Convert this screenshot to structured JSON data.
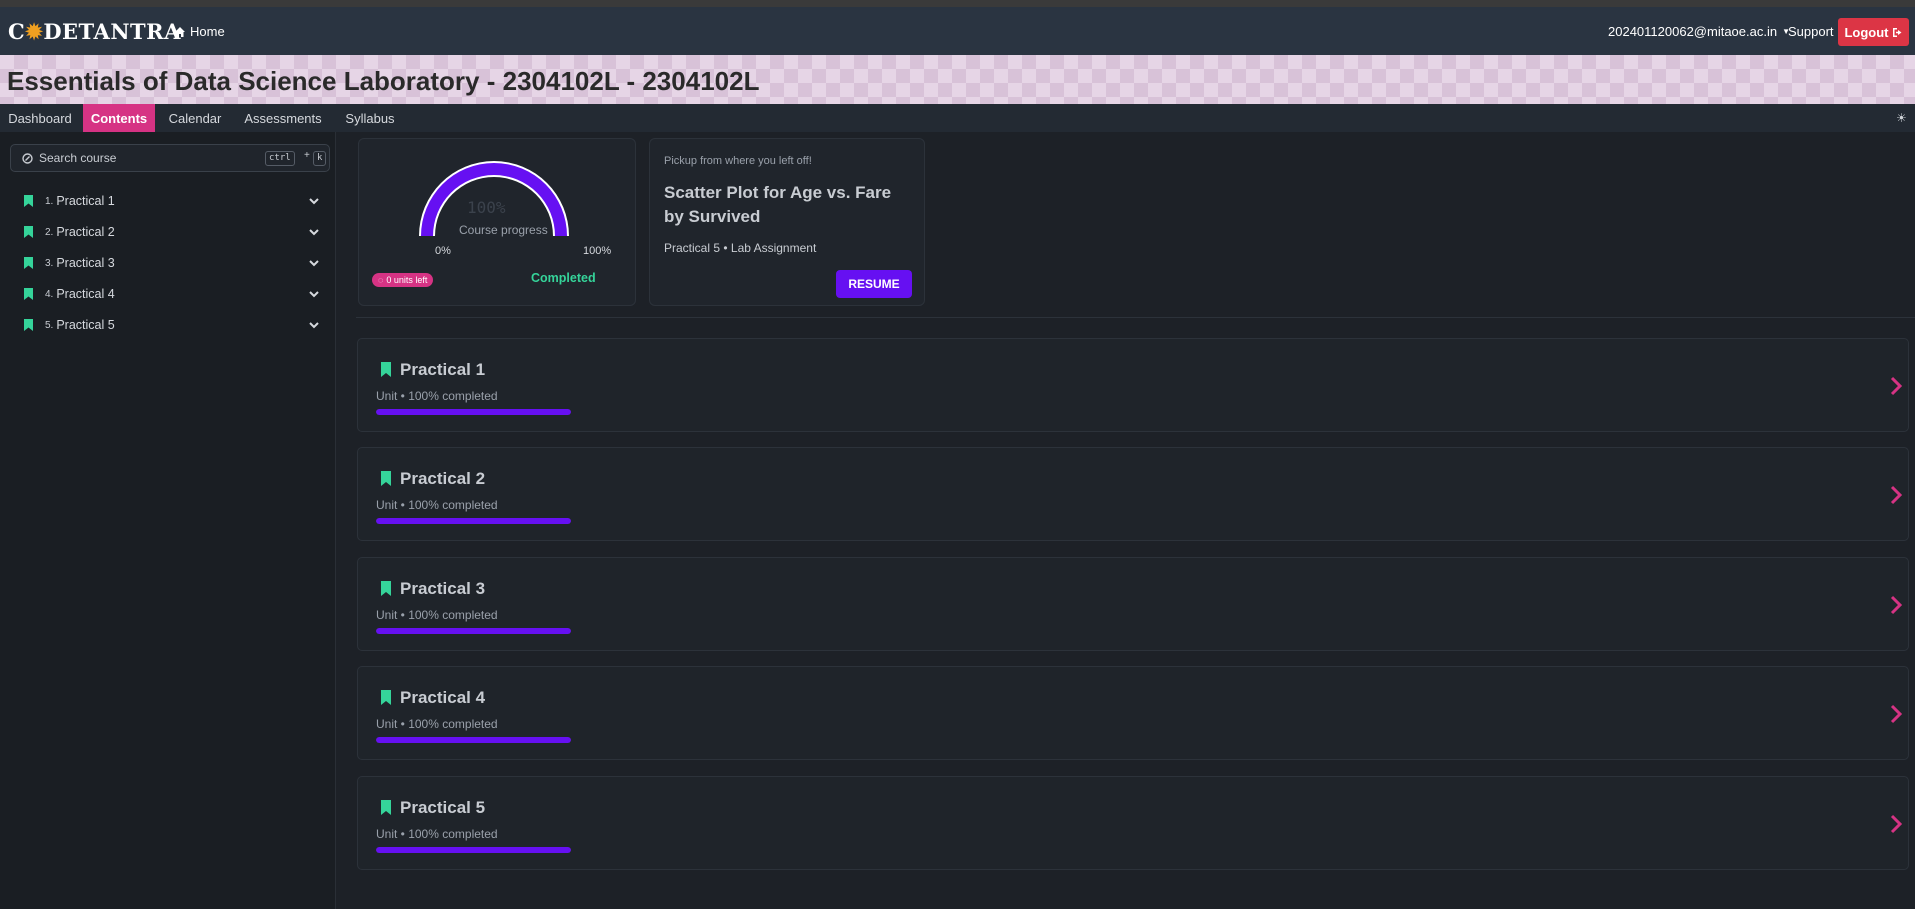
{
  "navbar": {
    "logo": "CODETANTRA",
    "home_label": "Home",
    "user_email": "202401120062@mitaoe.ac.in",
    "support_label": "Support",
    "logout_label": "Logout"
  },
  "banner": {
    "course_title": "Essentials of Data Science Laboratory - 2304102L - 2304102L"
  },
  "tabs": [
    {
      "label": "Dashboard"
    },
    {
      "label": "Contents",
      "active": true
    },
    {
      "label": "Calendar"
    },
    {
      "label": "Assessments"
    },
    {
      "label": "Syllabus"
    }
  ],
  "sidebar": {
    "search_placeholder": "Search course",
    "shortcut_key1": "ctrl",
    "shortcut_plus": "+",
    "shortcut_key2": "k",
    "items": [
      {
        "number": "1.",
        "label": "Practical 1"
      },
      {
        "number": "2.",
        "label": "Practical 2"
      },
      {
        "number": "3.",
        "label": "Practical 3"
      },
      {
        "number": "4.",
        "label": "Practical 4"
      },
      {
        "number": "5.",
        "label": "Practical 5"
      }
    ]
  },
  "progress": {
    "percent_text": "100%",
    "percent_value": 100,
    "label": "Course progress",
    "min_label": "0%",
    "max_label": "100%",
    "units_left": "0 units left",
    "status": "Completed"
  },
  "resume": {
    "pickup_text": "Pickup from where you left off!",
    "title": "Scatter Plot for Age vs. Fare by Survived",
    "subtitle": "Practical 5 • Lab Assignment",
    "button_label": "RESUME"
  },
  "units": [
    {
      "title": "Practical 1",
      "subtitle": "Unit • 100% completed",
      "progress": 1.0
    },
    {
      "title": "Practical 2",
      "subtitle": "Unit • 100% completed",
      "progress": 1.0
    },
    {
      "title": "Practical 3",
      "subtitle": "Unit • 100% completed",
      "progress": 1.0
    },
    {
      "title": "Practical 4",
      "subtitle": "Unit • 100% completed",
      "progress": 1.0
    },
    {
      "title": "Practical 5",
      "subtitle": "Unit • 100% completed",
      "progress": 1.0
    }
  ],
  "colors": {
    "accent_pink": "#d63384",
    "accent_purple": "#6610f2",
    "success_green": "#35d49a",
    "bookmark_green": "#35d49a",
    "logout_red": "#dc3545"
  }
}
